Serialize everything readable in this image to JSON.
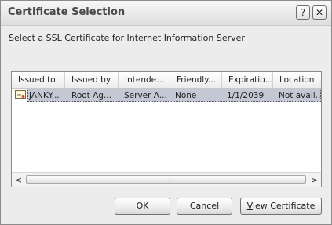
{
  "window": {
    "title": "Certificate Selection",
    "help_label": "?",
    "close_label": "✕"
  },
  "instruction": "Select a SSL Certificate for Internet Information Server",
  "table": {
    "columns": [
      "Issued to",
      "Issued by",
      "Intende...",
      "Friendly...",
      "Expiratio...",
      "Location"
    ],
    "rows": [
      {
        "issued_to": "JANKY...",
        "issued_by": "Root Ag...",
        "intended": "Server A...",
        "friendly": "None",
        "expiration": "1/1/2039",
        "location": "Not avail...",
        "selected": true,
        "icon": "certificate-icon"
      }
    ]
  },
  "scrollbar": {
    "left_arrow": "<",
    "right_arrow": ">",
    "thumb_grip": "|||"
  },
  "buttons": {
    "ok": "OK",
    "cancel": "Cancel",
    "view_certificate_first": "V",
    "view_certificate_rest": "iew Certificate"
  },
  "colors": {
    "selection": "#c4c8d4",
    "dialog_bg": "#ececec"
  }
}
